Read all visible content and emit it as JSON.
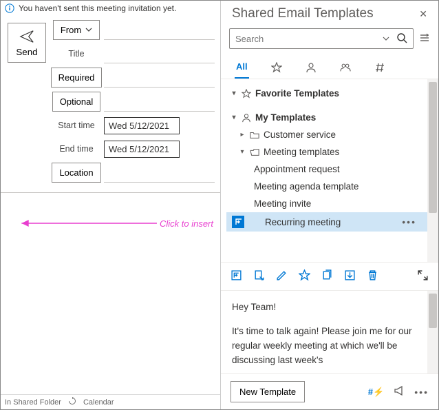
{
  "info_message": "You haven't sent this meeting invitation yet.",
  "compose": {
    "send": "Send",
    "from": "From",
    "title": "Title",
    "required": "Required",
    "optional": "Optional",
    "start_time": "Start time",
    "end_time": "End time",
    "start_date": "Wed 5/12/2021",
    "end_date": "Wed 5/12/2021",
    "location": "Location"
  },
  "annotation": "Click to insert",
  "statusbar": {
    "folder": "In Shared Folder",
    "calendar": "Calendar"
  },
  "pane": {
    "title": "Shared Email Templates",
    "search_placeholder": "Search",
    "tabs": {
      "all": "All"
    },
    "tree": {
      "favorites": "Favorite Templates",
      "my_templates": "My Templates",
      "customer_service": "Customer service",
      "meeting_templates": "Meeting templates",
      "items": {
        "appointment": "Appointment request",
        "agenda": "Meeting agenda template",
        "invite": "Meeting invite",
        "recurring": "Recurring meeting"
      }
    },
    "preview": {
      "p1": "Hey Team!",
      "p2": "It's time to talk again! Please join me for our regular weekly meeting at which we'll be discussing last week's"
    },
    "new_template": "New Template"
  }
}
